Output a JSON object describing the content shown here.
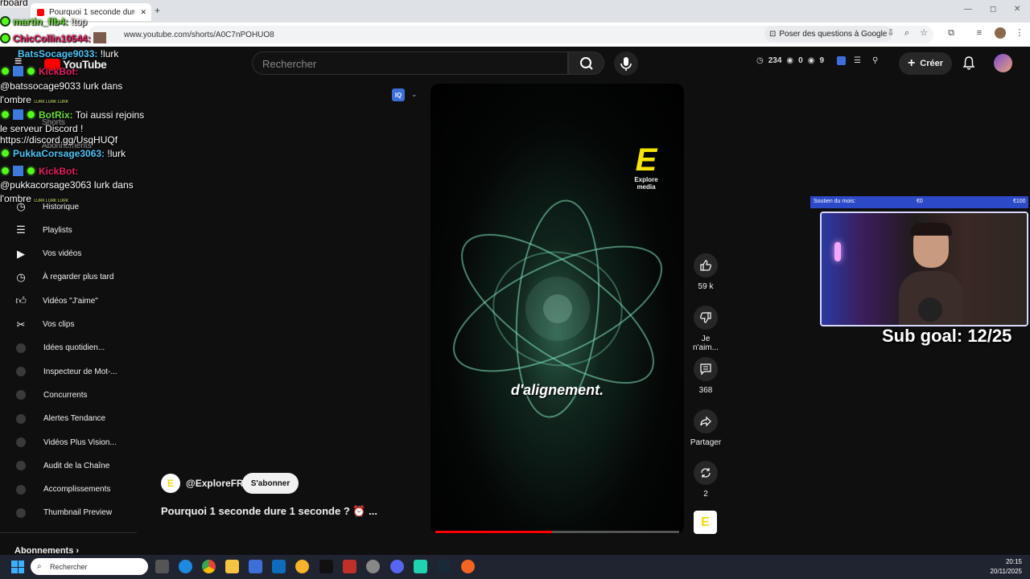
{
  "browser": {
    "tab_title": "Pourquoi 1 seconde dure",
    "url": "www.youtube.com/shorts/A0C7nPOHUO8",
    "ask_google": "Poser des questions à Google",
    "win_min": "—",
    "win_max": "◻",
    "win_close": "✕",
    "tab_close": "✕",
    "new_tab": "+"
  },
  "youtube": {
    "brand": "YouTube",
    "search_placeholder": "Rechercher",
    "stats": {
      "views": "234",
      "a": "0",
      "b": "9"
    },
    "create_label": "Créer"
  },
  "sidebar": {
    "shorts": "Shorts",
    "abonnements_top": "Abonnements",
    "items": [
      {
        "label": "Historique",
        "icon": "history-icon"
      },
      {
        "label": "Playlists",
        "icon": "playlist-icon"
      },
      {
        "label": "Vos vidéos",
        "icon": "video-icon"
      },
      {
        "label": "À regarder plus tard",
        "icon": "clock-icon"
      },
      {
        "label": "Vidéos \"J'aime\"",
        "icon": "thumbs-up-icon"
      },
      {
        "label": "Vos clips",
        "icon": "scissors-icon"
      },
      {
        "label": "Idées quotidien...",
        "icon": "vidiq-icon"
      },
      {
        "label": "Inspecteur de Mot-...",
        "icon": "vidiq-icon"
      },
      {
        "label": "Concurrents",
        "icon": "vidiq-icon"
      },
      {
        "label": "Alertes Tendance",
        "icon": "vidiq-icon"
      },
      {
        "label": "Vidéos Plus Vision...",
        "icon": "vidiq-icon"
      },
      {
        "label": "Audit de la Chaîne",
        "icon": "vidiq-icon"
      },
      {
        "label": "Accomplissements",
        "icon": "vidiq-icon"
      },
      {
        "label": "Thumbnail Preview",
        "icon": "vidiq-icon"
      }
    ],
    "abonnements_bottom": "Abonnements"
  },
  "chat": {
    "line0": "rboard",
    "l1_user": "martin_flb4:",
    "l1_msg": " !top",
    "l2_user": "ChicCollin10544:",
    "l3_user": "BatsSocage9033:",
    "l3_msg": " !lurk",
    "l4_user": "KickBot:",
    "l5": "@batssocage9033 lurk dans",
    "l6": "l'ombre",
    "l6_emote": "LURK LURK LURK",
    "l7_user": "BotRix:",
    "l7_msg": " Toi aussi rejoins",
    "l8": "le serveur Discord !",
    "l9": "https://discord.gg/UsqHUQf",
    "l10_user": "PukkaCorsage3063:",
    "l10_msg": " !lurk",
    "l11_user": "KickBot:",
    "l12": "@pukkacorsage3063 lurk dans",
    "l13": "l'ombre",
    "l13_emote": "LURK LURK LURK"
  },
  "video": {
    "caption": "d'alignement.",
    "logo_text_1": "Explore",
    "logo_text_2": "media",
    "progress_fraction": 0.48
  },
  "actions": {
    "likes": "59 k",
    "dislike": "Je n'aim...",
    "comments": "368",
    "share": "Partager",
    "remix": "2"
  },
  "channel": {
    "avatar_letter": "E",
    "name": "@ExploreFR",
    "subscribe": "S'abonner",
    "title": "Pourquoi 1 seconde dure 1 seconde ? ⏰ ..."
  },
  "stream": {
    "bar_label": "Soutien du mois:",
    "bar_min": "€0",
    "bar_max": "€100",
    "sub_goal": "Sub goal: 12/25"
  },
  "taskbar": {
    "search": "Rechercher",
    "time": "20:15",
    "date": "20/11/2025"
  }
}
